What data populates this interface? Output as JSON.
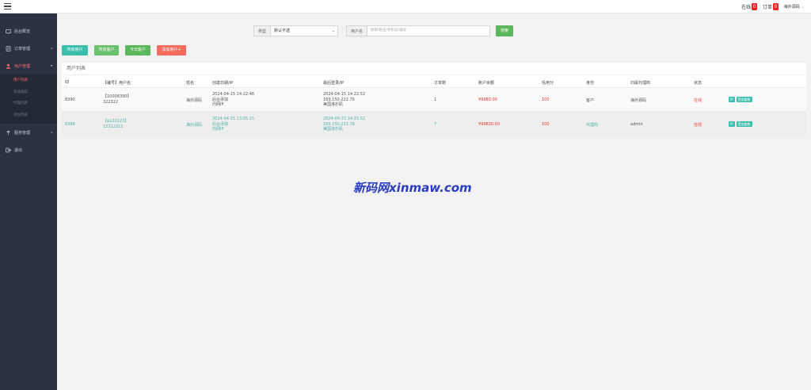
{
  "topbar": {
    "online_label": "在线",
    "online_count": "0",
    "orders_label": "订单",
    "orders_count": "0",
    "user_name": "海外源码",
    "caret": "⌄"
  },
  "sidebar": {
    "items": [
      {
        "label": "后台概览"
      },
      {
        "label": "订单管理",
        "arrow": "◂"
      },
      {
        "label": "用户管理",
        "arrow": "▾"
      },
      {
        "label": "服务管理",
        "arrow": "◂"
      },
      {
        "label": "退出"
      }
    ],
    "sub_items": [
      {
        "label": "用户列表"
      },
      {
        "label": "商品跟踪"
      },
      {
        "label": "代理列表"
      },
      {
        "label": "添加列表"
      }
    ]
  },
  "filter": {
    "type_label": "类型",
    "type_value": "默认不选",
    "user_label": "用户名",
    "user_placeholder": "昵称/姓名/手机号/编号",
    "search_label": "搜索"
  },
  "actions": {
    "all_users": "所有用户",
    "all_accounts": "所有客户",
    "today_accounts": "今日客户",
    "add_user": "添加用户+"
  },
  "panel": {
    "title": "用户列表"
  },
  "table": {
    "headers": [
      "ID",
      "【编号】用户名",
      "姓名",
      "创建日期/IP",
      "最后登录/IP",
      "订单数",
      "账户余额",
      "信用分",
      "身份",
      "归属代理商",
      "状态"
    ],
    "rows": [
      {
        "id": "8390",
        "code": "【10008390】",
        "username": "322322",
        "name": "海外源码",
        "created_date": "2024-04-15 14:22:46",
        "created_by": "后台添加",
        "created_ip": "内网IP",
        "last_date": "2024-04-15 14:22:52",
        "last_ip": "169.150.222.76",
        "last_loc": "美国洛杉矶",
        "orders": "1",
        "balance": "¥9980.00",
        "credit": "100",
        "role": "客户",
        "agent": "海外源码",
        "status": "在线",
        "op1": "IP",
        "op2": "登金额账"
      },
      {
        "id": "8388",
        "code": "【a123123】",
        "username": "12312311",
        "name": "海外源码",
        "created_date": "2024-04-15 13:05:15",
        "created_by": "后台添加",
        "created_ip": "内网IP",
        "last_date": "2024-04-15 14:21:52",
        "last_ip": "169.150.222.76",
        "last_loc": "美国洛杉矶",
        "orders": "7",
        "balance": "¥99820.00",
        "credit": "100",
        "role": "代理商",
        "agent": "admin",
        "status": "在线",
        "op1": "IP",
        "op2": "登金额账"
      }
    ]
  },
  "watermark": "新码网xinmaw.com",
  "colors": {
    "sidebar_bg": "#2b3342",
    "active_red": "#ff6b6b",
    "teal": "#3bbfad",
    "green": "#5cb85c",
    "red_button": "#f46c5e"
  },
  "icons": [
    "menu-icon",
    "home-icon",
    "orders-icon",
    "users-icon",
    "service-icon",
    "exit-icon"
  ]
}
